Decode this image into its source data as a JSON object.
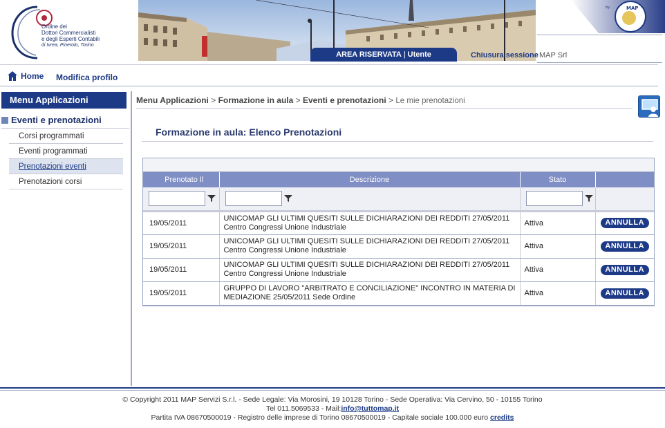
{
  "header": {
    "logo_lines": [
      "Ordine dei",
      "Dottori Commercialisti",
      "e degli Esperti Contabili",
      "di Ivrea, Pinerolo, Torino"
    ],
    "map_logo_small": "by",
    "map_logo_text": "MAP",
    "area_tab": "AREA RISERVATA",
    "area_sep": "|",
    "area_user": "Utente",
    "logout": "Chiusura sessione",
    "user_name": "MAP Srl"
  },
  "topnav": {
    "home": "Home",
    "profile": "Modifica profilo"
  },
  "sidebar": {
    "title": "Menu Applicazioni",
    "group": "Eventi e prenotazioni",
    "items": [
      {
        "label": "Corsi programmati",
        "active": false
      },
      {
        "label": "Eventi programmati",
        "active": false
      },
      {
        "label": "Prenotazioni eventi",
        "active": true
      },
      {
        "label": "Prenotazioni corsi",
        "active": false
      }
    ]
  },
  "breadcrumb": {
    "b1": "Menu Applicazioni",
    "b2": "Formazione in aula",
    "b3": "Eventi e prenotazioni",
    "sep": ">",
    "current": "Le mie prenotazioni"
  },
  "main": {
    "title": "Formazione in aula: Elenco Prenotazioni"
  },
  "table": {
    "headers": [
      "Prenotato Il",
      "Descrizione",
      "Stato",
      ""
    ],
    "action_label": "ANNULLA",
    "rows": [
      {
        "date": "19/05/2011",
        "desc1": "UNICOMAP GLI ULTIMI QUESITI SULLE DICHIARAZIONI DEI REDDITI 27/05/2011",
        "desc2": "Centro Congressi Unione Industriale",
        "stato": "Attiva"
      },
      {
        "date": "19/05/2011",
        "desc1": "UNICOMAP GLI ULTIMI QUESITI SULLE DICHIARAZIONI DEI REDDITI 27/05/2011",
        "desc2": "Centro Congressi Unione Industriale",
        "stato": "Attiva"
      },
      {
        "date": "19/05/2011",
        "desc1": "UNICOMAP GLI ULTIMI QUESITI SULLE DICHIARAZIONI DEI REDDITI 27/05/2011",
        "desc2": "Centro Congressi Unione Industriale",
        "stato": "Attiva"
      },
      {
        "date": "19/05/2011",
        "desc1": "GRUPPO DI LAVORO \"ARBITRATO E CONCILIAZIONE\" INCONTRO IN MATERIA DI",
        "desc2": "MEDIAZIONE 25/05/2011 Sede Ordine",
        "stato": "Attiva"
      }
    ]
  },
  "footer": {
    "line1": "© Copyright 2011 MAP Servizi S.r.l. - Sede Legale: Via Morosini, 19 10128 Torino - Sede Operativa: Via Cervino, 50 - 10155 Torino",
    "line2_prefix": "Tel 011.5069533 - Mail:",
    "email": "info@tuttomap.it",
    "line3": "Partita IVA 08670500019  -  Registro delle imprese di Torino 08670500019 - Capitale sociale 100.000 euro",
    "credits": "credits"
  },
  "colors": {
    "primary": "#1d3a86",
    "table_header": "#7f8ec4",
    "active_item_bg": "#dde3ef"
  }
}
